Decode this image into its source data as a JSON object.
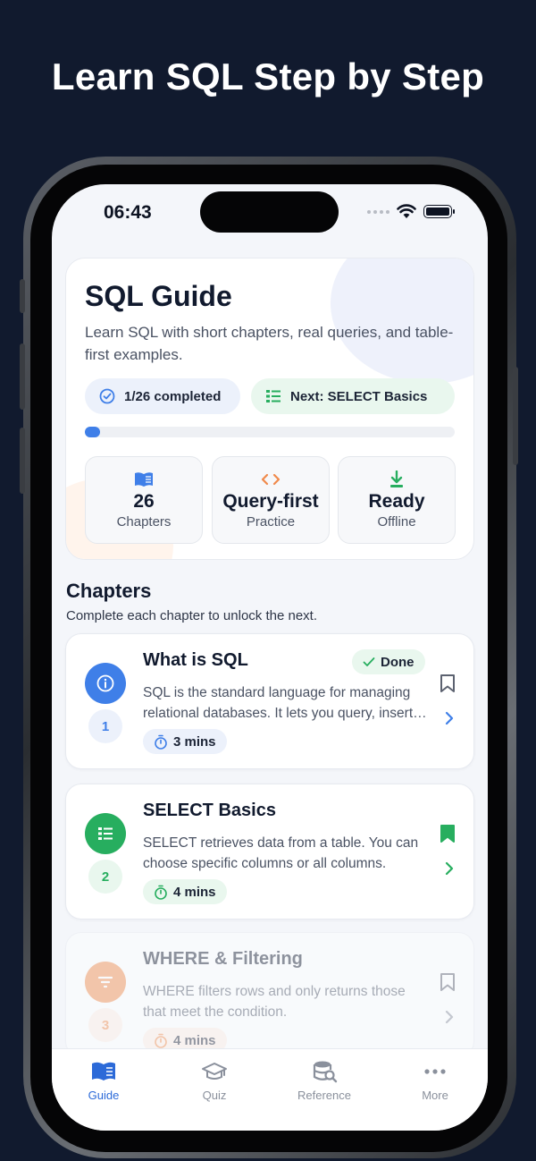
{
  "headline": "Learn SQL Step by Step",
  "status_bar": {
    "time": "06:43"
  },
  "hero": {
    "title": "SQL Guide",
    "subtitle": "Learn SQL with short chapters, real queries, and table-first examples.",
    "completed_label": "1/26 completed",
    "next_label": "Next: SELECT Basics",
    "progress_fraction": 0.04,
    "stats": [
      {
        "icon": "book-icon",
        "value": "26",
        "label": "Chapters"
      },
      {
        "icon": "code-icon",
        "value": "Query-first",
        "label": "Practice"
      },
      {
        "icon": "download-icon",
        "value": "Ready",
        "label": "Offline"
      }
    ]
  },
  "chapters_section": {
    "title": "Chapters",
    "subtitle": "Complete each chapter to unlock the next.",
    "items": [
      {
        "number": "1",
        "title": "What is SQL",
        "description": "SQL is the standard language for managing relational databases. It lets you query, insert, update and delete data.",
        "duration": "3 mins",
        "badge": "Done",
        "bookmarked": false,
        "color": "#3f7fe8"
      },
      {
        "number": "2",
        "title": "SELECT Basics",
        "description": "SELECT retrieves data from a table. You can choose specific columns or all columns.",
        "duration": "4 mins",
        "bookmarked": true,
        "color": "#27ae5f"
      },
      {
        "number": "3",
        "title": "WHERE & Filtering",
        "description": "WHERE filters rows and only returns those that meet the condition.",
        "duration": "4 mins",
        "bookmarked": false,
        "locked": true,
        "color": "#f08a4b"
      }
    ]
  },
  "tabs": [
    {
      "label": "Guide",
      "icon": "book-icon",
      "active": true
    },
    {
      "label": "Quiz",
      "icon": "graduation-cap-icon",
      "active": false
    },
    {
      "label": "Reference",
      "icon": "database-search-icon",
      "active": false
    },
    {
      "label": "More",
      "icon": "more-dots-icon",
      "active": false
    }
  ],
  "colors": {
    "background": "#111a2e",
    "accent": "#3f7fe8",
    "success": "#27ae5f",
    "warning": "#f08a4b"
  }
}
